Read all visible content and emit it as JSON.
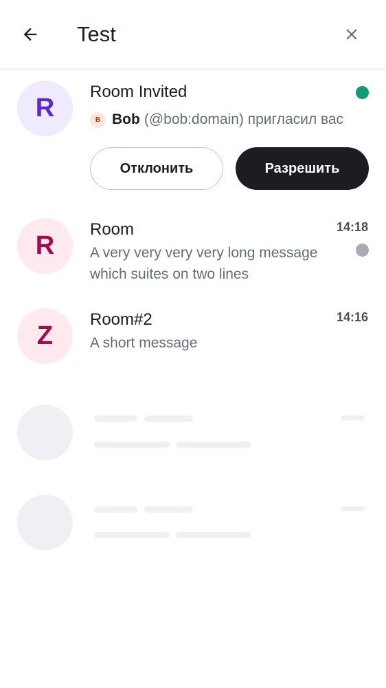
{
  "header": {
    "back_icon": "arrow-left-icon",
    "title": "Test",
    "close_icon": "close-icon"
  },
  "invite": {
    "avatar_letter": "R",
    "avatar_bg": "#efeafe",
    "avatar_fg": "#5b27cf",
    "room_name": "Room Invited",
    "inviter_initial": "B",
    "inviter_name": "Bob",
    "inviter_rest": "(@bob:domain) пригласил вас",
    "decline_label": "Отклонить",
    "accept_label": "Разрешить",
    "indicator_color": "#0d9c77"
  },
  "rooms": [
    {
      "avatar_letter": "R",
      "avatar_bg": "#fde9ee",
      "avatar_fg": "#a50b4a",
      "name": "Room",
      "time": "14:18",
      "preview": "A very very very very long message which suites on two lines",
      "unread_indicator_color": "#a8abb3"
    },
    {
      "avatar_letter": "Z",
      "avatar_bg": "#fde9ee",
      "avatar_fg": "#a50b4a",
      "name": "Room#2",
      "time": "14:16",
      "preview": "A short message"
    }
  ],
  "placeholders_count": 2
}
